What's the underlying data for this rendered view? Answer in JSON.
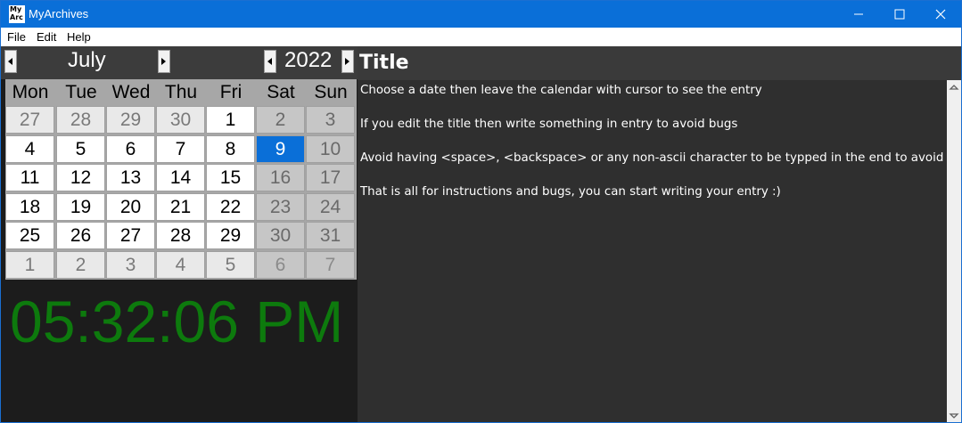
{
  "window": {
    "title": "MyArchives",
    "icon_text_1": "My",
    "icon_text_2": "Arc"
  },
  "menu": {
    "file": "File",
    "edit": "Edit",
    "help": "Help"
  },
  "calendar": {
    "month": "July",
    "year": "2022",
    "weekdays": [
      "Mon",
      "Tue",
      "Wed",
      "Thu",
      "Fri",
      "Sat",
      "Sun"
    ],
    "weeks": [
      [
        "27",
        "28",
        "29",
        "30",
        "1",
        "2",
        "3"
      ],
      [
        "4",
        "5",
        "6",
        "7",
        "8",
        "9",
        "10"
      ],
      [
        "11",
        "12",
        "13",
        "14",
        "15",
        "16",
        "17"
      ],
      [
        "18",
        "19",
        "20",
        "21",
        "22",
        "23",
        "24"
      ],
      [
        "25",
        "26",
        "27",
        "28",
        "29",
        "30",
        "31"
      ],
      [
        "1",
        "2",
        "3",
        "4",
        "5",
        "6",
        "7"
      ]
    ],
    "selected_day": "9"
  },
  "clock": {
    "time": "05:32:06 PM"
  },
  "entry": {
    "title": "Title",
    "lines": [
      "Choose a date then leave the calendar with cursor to see the entry",
      "If you edit the title then write something in entry to avoid bugs",
      "Avoid having <space>, <backspace> or any non-ascii character to be typped in the end to avoid bugs",
      "That is all for instructions and bugs, you can start writing your entry :)"
    ]
  },
  "colors": {
    "titlebar": "#0a6fd8",
    "selected": "#0a6fd8",
    "clock": "#0d7a0d"
  }
}
